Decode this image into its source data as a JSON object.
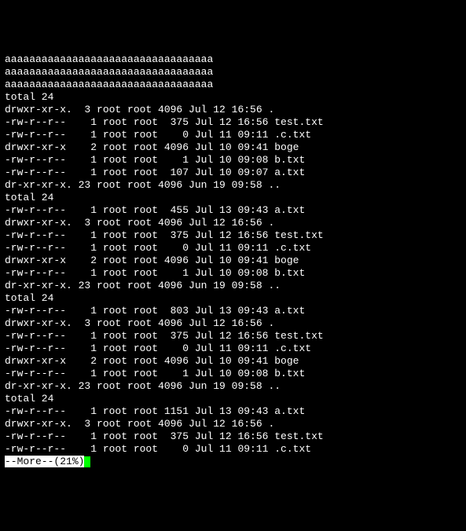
{
  "header_lines": [
    "aaaaaaaaaaaaaaaaaaaaaaaaaaaaaaaaaa",
    "aaaaaaaaaaaaaaaaaaaaaaaaaaaaaaaaaa",
    "aaaaaaaaaaaaaaaaaaaaaaaaaaaaaaaaaa"
  ],
  "blocks": [
    {
      "total": "total 24",
      "rows": [
        {
          "perm": "drwxr-xr-x.",
          "links": " 3",
          "owner": "root",
          "group": "root",
          "size": "4096",
          "date": "Jul 12 16:56",
          "name": "."
        },
        {
          "perm": "-rw-r--r--",
          "links": "  1",
          "owner": "root",
          "group": "root",
          "size": " 375",
          "date": "Jul 12 16:56",
          "name": "test.txt"
        },
        {
          "perm": "-rw-r--r--",
          "links": "  1",
          "owner": "root",
          "group": "root",
          "size": "   0",
          "date": "Jul 11 09:11",
          "name": ".c.txt"
        },
        {
          "perm": "drwxr-xr-x",
          "links": "  2",
          "owner": "root",
          "group": "root",
          "size": "4096",
          "date": "Jul 10 09:41",
          "name": "boge"
        },
        {
          "perm": "-rw-r--r--",
          "links": "  1",
          "owner": "root",
          "group": "root",
          "size": "   1",
          "date": "Jul 10 09:08",
          "name": "b.txt"
        },
        {
          "perm": "-rw-r--r--",
          "links": "  1",
          "owner": "root",
          "group": "root",
          "size": " 107",
          "date": "Jul 10 09:07",
          "name": "a.txt"
        },
        {
          "perm": "dr-xr-xr-x.",
          "links": "23",
          "owner": "root",
          "group": "root",
          "size": "4096",
          "date": "Jun 19 09:58",
          "name": ".."
        }
      ]
    },
    {
      "total": "total 24",
      "rows": [
        {
          "perm": "-rw-r--r--",
          "links": "  1",
          "owner": "root",
          "group": "root",
          "size": " 455",
          "date": "Jul 13 09:43",
          "name": "a.txt"
        },
        {
          "perm": "drwxr-xr-x.",
          "links": " 3",
          "owner": "root",
          "group": "root",
          "size": "4096",
          "date": "Jul 12 16:56",
          "name": "."
        },
        {
          "perm": "-rw-r--r--",
          "links": "  1",
          "owner": "root",
          "group": "root",
          "size": " 375",
          "date": "Jul 12 16:56",
          "name": "test.txt"
        },
        {
          "perm": "-rw-r--r--",
          "links": "  1",
          "owner": "root",
          "group": "root",
          "size": "   0",
          "date": "Jul 11 09:11",
          "name": ".c.txt"
        },
        {
          "perm": "drwxr-xr-x",
          "links": "  2",
          "owner": "root",
          "group": "root",
          "size": "4096",
          "date": "Jul 10 09:41",
          "name": "boge"
        },
        {
          "perm": "-rw-r--r--",
          "links": "  1",
          "owner": "root",
          "group": "root",
          "size": "   1",
          "date": "Jul 10 09:08",
          "name": "b.txt"
        },
        {
          "perm": "dr-xr-xr-x.",
          "links": "23",
          "owner": "root",
          "group": "root",
          "size": "4096",
          "date": "Jun 19 09:58",
          "name": ".."
        }
      ]
    },
    {
      "total": "total 24",
      "rows": [
        {
          "perm": "-rw-r--r--",
          "links": "  1",
          "owner": "root",
          "group": "root",
          "size": " 803",
          "date": "Jul 13 09:43",
          "name": "a.txt"
        },
        {
          "perm": "drwxr-xr-x.",
          "links": " 3",
          "owner": "root",
          "group": "root",
          "size": "4096",
          "date": "Jul 12 16:56",
          "name": "."
        },
        {
          "perm": "-rw-r--r--",
          "links": "  1",
          "owner": "root",
          "group": "root",
          "size": " 375",
          "date": "Jul 12 16:56",
          "name": "test.txt"
        },
        {
          "perm": "-rw-r--r--",
          "links": "  1",
          "owner": "root",
          "group": "root",
          "size": "   0",
          "date": "Jul 11 09:11",
          "name": ".c.txt"
        },
        {
          "perm": "drwxr-xr-x",
          "links": "  2",
          "owner": "root",
          "group": "root",
          "size": "4096",
          "date": "Jul 10 09:41",
          "name": "boge"
        },
        {
          "perm": "-rw-r--r--",
          "links": "  1",
          "owner": "root",
          "group": "root",
          "size": "   1",
          "date": "Jul 10 09:08",
          "name": "b.txt"
        },
        {
          "perm": "dr-xr-xr-x.",
          "links": "23",
          "owner": "root",
          "group": "root",
          "size": "4096",
          "date": "Jun 19 09:58",
          "name": ".."
        }
      ]
    },
    {
      "total": "total 24",
      "rows": [
        {
          "perm": "-rw-r--r--",
          "links": "  1",
          "owner": "root",
          "group": "root",
          "size": "1151",
          "date": "Jul 13 09:43",
          "name": "a.txt"
        },
        {
          "perm": "drwxr-xr-x.",
          "links": " 3",
          "owner": "root",
          "group": "root",
          "size": "4096",
          "date": "Jul 12 16:56",
          "name": "."
        },
        {
          "perm": "-rw-r--r--",
          "links": "  1",
          "owner": "root",
          "group": "root",
          "size": " 375",
          "date": "Jul 12 16:56",
          "name": "test.txt"
        },
        {
          "perm": "-rw-r--r--",
          "links": "  1",
          "owner": "root",
          "group": "root",
          "size": "   0",
          "date": "Jul 11 09:11",
          "name": ".c.txt"
        }
      ]
    }
  ],
  "pager": {
    "label": "--More--",
    "percent": "(21%)"
  }
}
